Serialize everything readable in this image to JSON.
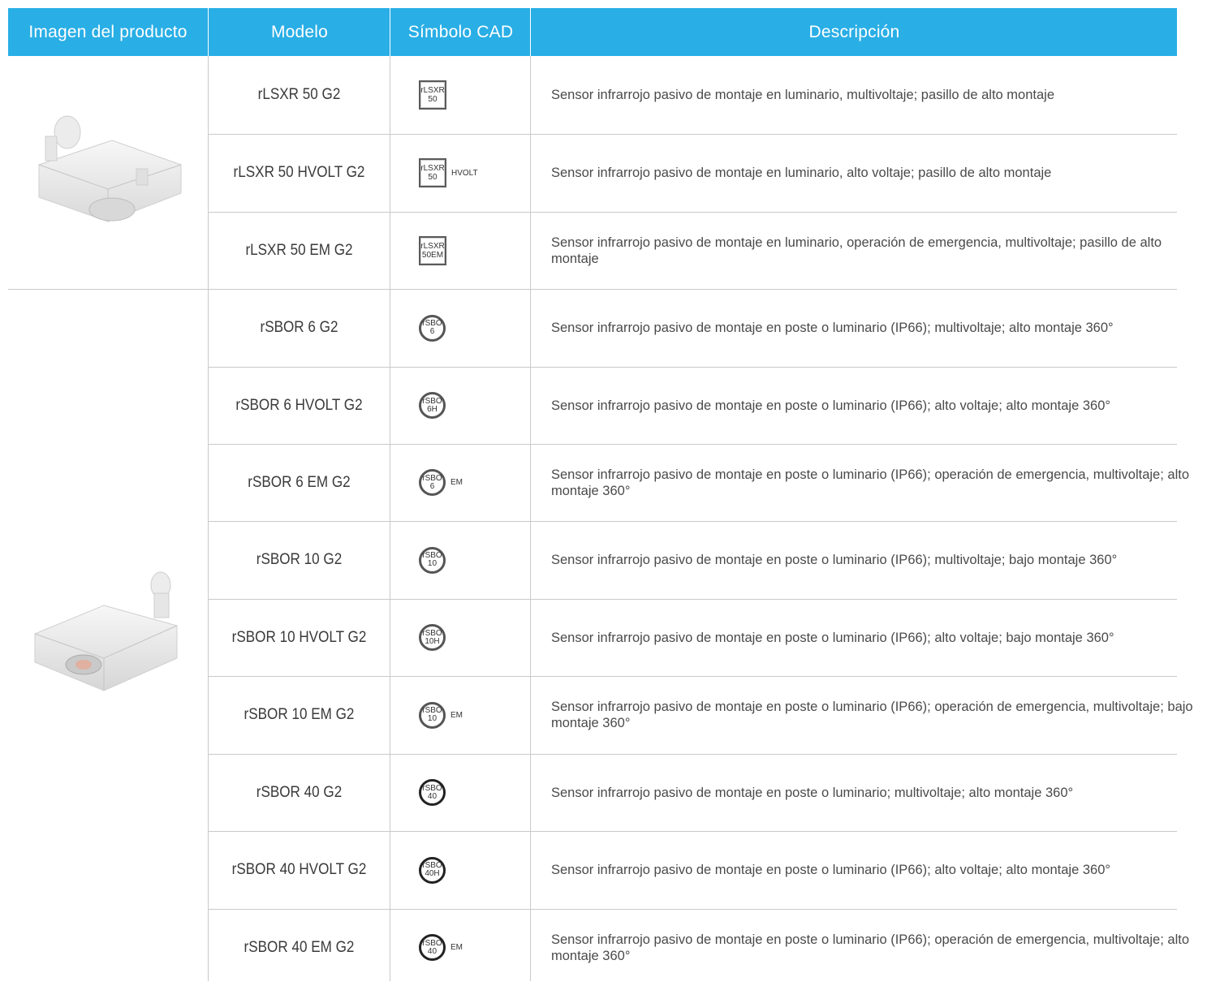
{
  "header": {
    "image_col": "Imagen del producto",
    "model_col": "Modelo",
    "cad_col": "Símbolo CAD",
    "desc_col": "Descripción"
  },
  "colors": {
    "header_bg": "#29aee6",
    "header_text": "#ffffff",
    "grid_line": "#c9c9c9"
  },
  "groups": [
    {
      "image_icon": "lsxr-sensor-image",
      "rows": [
        {
          "model": "rLSXR 50 G2",
          "cad_shape": "square",
          "cad_text": "rLSXR\n50",
          "cad_suffix": "",
          "description": "Sensor infrarrojo pasivo de montaje en luminario, multivoltaje; pasillo de alto montaje"
        },
        {
          "model": "rLSXR 50 HVOLT G2",
          "cad_shape": "square",
          "cad_text": "rLSXR\n50",
          "cad_suffix": "HVOLT",
          "description": "Sensor infrarrojo pasivo de montaje en luminario, alto voltaje; pasillo de alto montaje"
        },
        {
          "model": "rLSXR 50 EM G2",
          "cad_shape": "square",
          "cad_text": "rLSXR\n50EM",
          "cad_suffix": "",
          "description": "Sensor infrarrojo pasivo de montaje en luminario, operación de emergencia, multivoltaje; pasillo de alto montaje"
        }
      ]
    },
    {
      "image_icon": "sbor-sensor-image",
      "rows": [
        {
          "model": "rSBOR 6 G2",
          "cad_shape": "circle",
          "cad_text": "rSBO\n6",
          "cad_suffix": "",
          "description": "Sensor infrarrojo pasivo de montaje en poste o luminario (IP66); multivoltaje; alto montaje 360°"
        },
        {
          "model": "rSBOR 6 HVOLT G2",
          "cad_shape": "circle",
          "cad_text": "rSBO\n6H",
          "cad_suffix": "",
          "description": "Sensor infrarrojo pasivo de montaje en poste o luminario (IP66); alto voltaje; alto montaje 360°"
        },
        {
          "model": "rSBOR 6 EM G2",
          "cad_shape": "circle",
          "cad_text": "rSBO\n6",
          "cad_suffix": "EM",
          "description": "Sensor infrarrojo pasivo de montaje en poste o luminario (IP66); operación de emergencia, multivoltaje; alto montaje 360°"
        },
        {
          "model": "rSBOR 10 G2",
          "cad_shape": "circle",
          "cad_text": "rSBO\n10",
          "cad_suffix": "",
          "description": "Sensor infrarrojo pasivo de montaje en poste o luminario (IP66); multivoltaje; bajo montaje 360°"
        },
        {
          "model": "rSBOR 10 HVOLT G2",
          "cad_shape": "circle",
          "cad_text": "rSBO\n10H",
          "cad_suffix": "",
          "description": "Sensor infrarrojo pasivo de montaje en poste o luminario (IP66); alto voltaje; bajo montaje 360°"
        },
        {
          "model": "rSBOR 10 EM G2",
          "cad_shape": "circle",
          "cad_text": "rSBO\n10",
          "cad_suffix": "EM",
          "description": "Sensor infrarrojo pasivo de montaje en poste o luminario (IP66); operación de emergencia, multivoltaje; bajo montaje 360°"
        },
        {
          "model": "rSBOR 40 G2",
          "cad_shape": "circle-dark",
          "cad_text": "rSBO\n40",
          "cad_suffix": "",
          "description": "Sensor infrarrojo pasivo de montaje en poste o luminario; multivoltaje; alto montaje 360°"
        },
        {
          "model": "rSBOR 40 HVOLT G2",
          "cad_shape": "circle-dark",
          "cad_text": "rSBO\n40H",
          "cad_suffix": "",
          "description": "Sensor infrarrojo pasivo de montaje en poste o luminario (IP66); alto voltaje; alto montaje 360°"
        },
        {
          "model": "rSBOR 40 EM G2",
          "cad_shape": "circle-dark",
          "cad_text": "rSBO\n40",
          "cad_suffix": "EM",
          "description": "Sensor infrarrojo pasivo de montaje en poste o luminario (IP66); operación de emergencia, multivoltaje; alto montaje 360°"
        }
      ]
    }
  ]
}
